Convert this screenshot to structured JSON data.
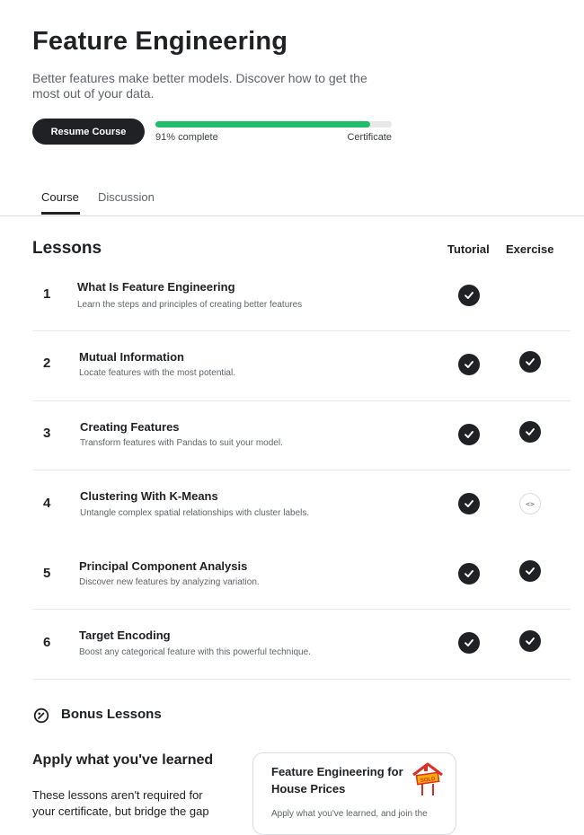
{
  "course": {
    "title": "Feature Engineering",
    "subtitle": "Better features make better models. Discover how to get the most out of your data.",
    "resume_label": "Resume Course",
    "progress_label": "91% complete",
    "progress_fraction": 0.91,
    "certificate_label": "Certificate"
  },
  "tabs": [
    {
      "label": "Course",
      "active": true
    },
    {
      "label": "Discussion",
      "active": false
    }
  ],
  "lessons_section": {
    "heading": "Lessons",
    "tutorial_header": "Tutorial",
    "exercise_header": "Exercise"
  },
  "lessons": [
    {
      "num": "1",
      "title": "What Is Feature Engineering",
      "desc": "Learn the steps and principles of creating better features",
      "tutorial": "done",
      "exercise": "none"
    },
    {
      "num": "2",
      "title": "Mutual Information",
      "desc": "Locate features with the most potential.",
      "tutorial": "done",
      "exercise": "done"
    },
    {
      "num": "3",
      "title": "Creating Features",
      "desc": "Transform features with Pandas to suit your model.",
      "tutorial": "done",
      "exercise": "done"
    },
    {
      "num": "4",
      "title": "Clustering With K-Means",
      "desc": "Untangle complex spatial relationships with cluster labels.",
      "tutorial": "done",
      "exercise": "code"
    },
    {
      "num": "5",
      "title": "Principal Component Analysis",
      "desc": "Discover new features by analyzing variation.",
      "tutorial": "done",
      "exercise": "done"
    },
    {
      "num": "6",
      "title": "Target Encoding",
      "desc": "Boost any categorical feature with this powerful technique.",
      "tutorial": "done",
      "exercise": "done"
    }
  ],
  "icons": {
    "check": "check-circle-icon",
    "code": "code-icon",
    "bonus": "bonus-icon",
    "house": "house-sold-sign-icon"
  },
  "bonus": {
    "heading": "Bonus Lessons",
    "apply_heading": "Apply what you've learned",
    "apply_text": "These lessons aren't required for your certificate, but bridge the gap",
    "card_title": "Feature Engineering for House Prices",
    "card_desc": "Apply what you've learned, and join the"
  },
  "colors": {
    "accent_green": "#20be6a",
    "dark": "#202124"
  }
}
